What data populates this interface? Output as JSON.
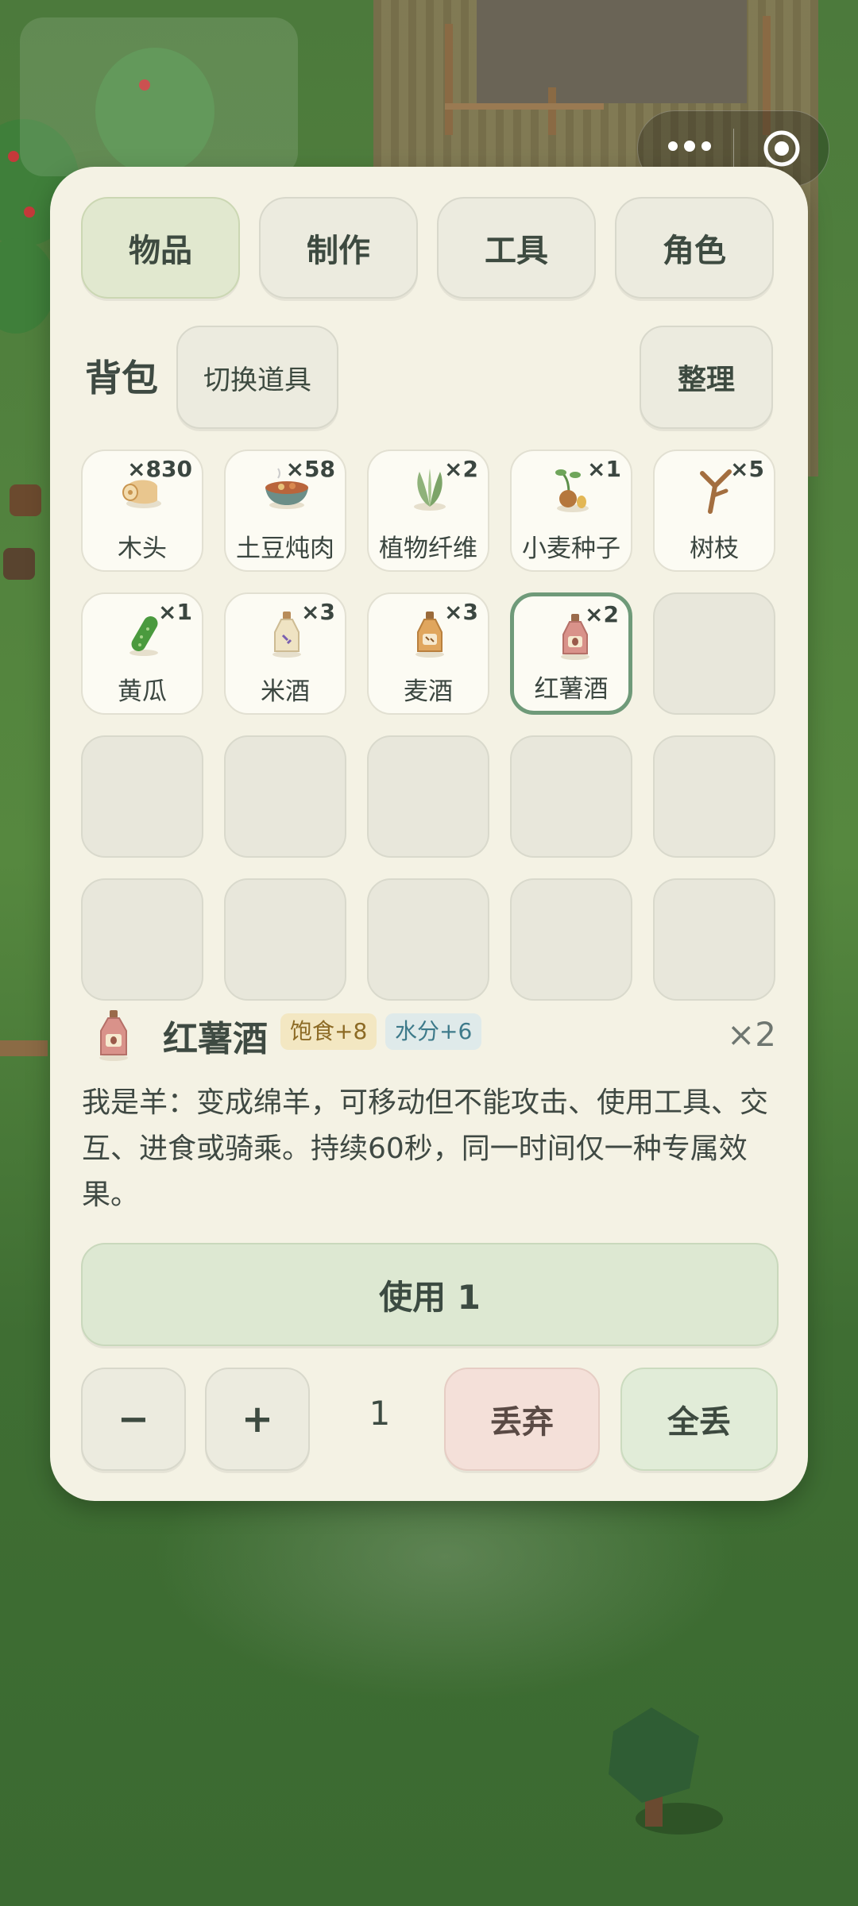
{
  "tabs": [
    {
      "label": "物品",
      "active": true
    },
    {
      "label": "制作",
      "active": false
    },
    {
      "label": "工具",
      "active": false
    },
    {
      "label": "角色",
      "active": false
    }
  ],
  "bag": {
    "title": "背包",
    "switch_label": "切换道具",
    "sort_label": "整理"
  },
  "items": [
    {
      "name": "木头",
      "qty": "×830",
      "icon": "wood-log-icon"
    },
    {
      "name": "土豆炖肉",
      "qty": "×58",
      "icon": "potato-stew-icon"
    },
    {
      "name": "植物纤维",
      "qty": "×2",
      "icon": "plant-fiber-icon"
    },
    {
      "name": "小麦种子",
      "qty": "×1",
      "icon": "wheat-seed-icon"
    },
    {
      "name": "树枝",
      "qty": "×5",
      "icon": "branch-icon"
    },
    {
      "name": "黄瓜",
      "qty": "×1",
      "icon": "cucumber-icon"
    },
    {
      "name": "米酒",
      "qty": "×3",
      "icon": "rice-wine-icon"
    },
    {
      "name": "麦酒",
      "qty": "×3",
      "icon": "ale-icon"
    },
    {
      "name": "红薯酒",
      "qty": "×2",
      "icon": "sweet-potato-wine-icon",
      "selected": true
    }
  ],
  "empty_slots": 11,
  "detail": {
    "name": "红薯酒",
    "tag_food": "饱食+8",
    "tag_water": "水分+6",
    "count": "×2",
    "description": "我是羊：变成绵羊，可移动但不能攻击、使用工具、交互、进食或骑乘。持续60秒，同一时间仅一种专属效果。"
  },
  "actions": {
    "use_label": "使用 1",
    "minus_label": "−",
    "plus_label": "+",
    "amount": "1",
    "discard_label": "丢弃",
    "discard_all_label": "全丢"
  },
  "colors": {
    "panel": "#f4f2e4",
    "accent_green": "#6f9a79",
    "discard_bg": "#f4e0d9"
  }
}
